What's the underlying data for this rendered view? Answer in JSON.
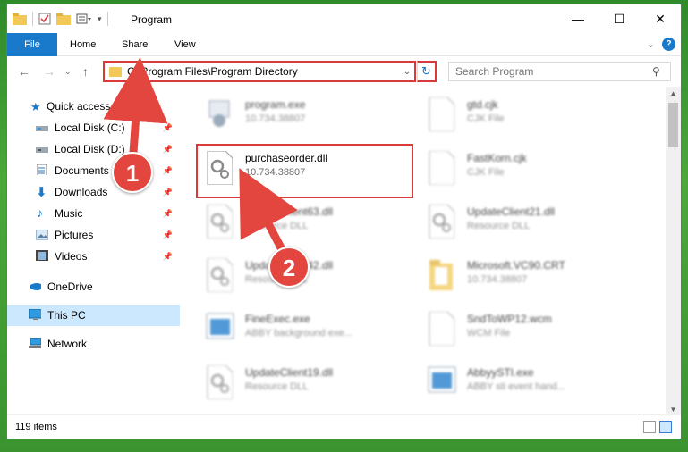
{
  "window": {
    "title": "Program"
  },
  "ribbon": {
    "tabs": [
      "File",
      "Home",
      "Share",
      "View"
    ],
    "help_label": "?"
  },
  "navigation": {
    "address_path": "C:\\Program Files\\Program Directory",
    "search_placeholder": "Search Program"
  },
  "sidebar": {
    "items": [
      {
        "label": "Quick access",
        "icon": "star-icon",
        "pinned": false
      },
      {
        "label": "Local Disk (C:)",
        "icon": "drive-icon",
        "pinned": true
      },
      {
        "label": "Local Disk (D:)",
        "icon": "drive-icon",
        "pinned": true
      },
      {
        "label": "Documents",
        "icon": "documents-icon",
        "pinned": true
      },
      {
        "label": "Downloads",
        "icon": "download-icon",
        "pinned": true
      },
      {
        "label": "Music",
        "icon": "music-icon",
        "pinned": true
      },
      {
        "label": "Pictures",
        "icon": "pictures-icon",
        "pinned": true
      },
      {
        "label": "Videos",
        "icon": "videos-icon",
        "pinned": true
      },
      {
        "label": "OneDrive",
        "icon": "cloud-icon",
        "pinned": false
      },
      {
        "label": "This PC",
        "icon": "computer-icon",
        "pinned": false
      },
      {
        "label": "Network",
        "icon": "network-icon",
        "pinned": false
      }
    ]
  },
  "files": [
    {
      "name": "program.exe",
      "sub": "10.734.38807",
      "type": "exe"
    },
    {
      "name": "gtd.cjk",
      "sub": "CJK File",
      "type": "doc"
    },
    {
      "name": "purchaseorder.dll",
      "sub": "10.734.38807",
      "type": "dll"
    },
    {
      "name": "FastKorn.cjk",
      "sub": "CJK File",
      "type": "doc"
    },
    {
      "name": "UpdateClient63.dll",
      "sub": "Resource DLL",
      "type": "dll"
    },
    {
      "name": "UpdateClient21.dll",
      "sub": "Resource DLL",
      "type": "dll"
    },
    {
      "name": "UpdateClient42.dll",
      "sub": "Resource DLL",
      "type": "dll"
    },
    {
      "name": "Microsoft.VC90.CRT",
      "sub": "10.734.38807",
      "type": "folder"
    },
    {
      "name": "FineExec.exe",
      "sub": "ABBY background exe...",
      "type": "app"
    },
    {
      "name": "SndToWP12.wcm",
      "sub": "WCM File",
      "type": "doc"
    },
    {
      "name": "UpdateClient19.dll",
      "sub": "Resource DLL",
      "type": "dll"
    },
    {
      "name": "AbbyySTI.exe",
      "sub": "ABBY sti event hand...",
      "type": "app"
    }
  ],
  "status": {
    "item_count": "119 items"
  },
  "annotations": {
    "step1": "1",
    "step2": "2"
  },
  "colors": {
    "accent": "#1979ca",
    "annotation": "#d93a3a",
    "selected": "#cce8ff"
  }
}
